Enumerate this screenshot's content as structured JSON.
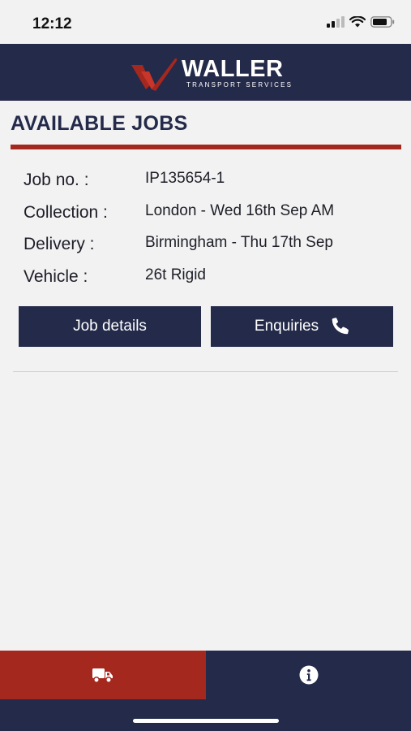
{
  "status_bar": {
    "time": "12:12",
    "icons": [
      "cellular-signal-icon",
      "wifi-icon",
      "battery-icon"
    ]
  },
  "header": {
    "brand_name": "WALLER",
    "brand_tagline": "TRANSPORT SERVICES",
    "colors": {
      "navy": "#242a4a",
      "red": "#a5281f"
    }
  },
  "page": {
    "title": "AVAILABLE JOBS"
  },
  "job": {
    "rows": [
      {
        "label": "Job no. :",
        "value": "IP135654-1"
      },
      {
        "label": "Collection :",
        "value": "London - Wed 16th Sep AM"
      },
      {
        "label": "Delivery :",
        "value": "Birmingham - Thu 17th Sep"
      },
      {
        "label": "Vehicle :",
        "value": "26t Rigid"
      }
    ],
    "buttons": {
      "details_label": "Job details",
      "enquiries_label": "Enquiries",
      "enquiries_icon": "phone-icon"
    }
  },
  "bottom_nav": {
    "tabs": [
      {
        "icon": "truck-icon",
        "active": true
      },
      {
        "icon": "info-icon",
        "active": false
      }
    ]
  }
}
